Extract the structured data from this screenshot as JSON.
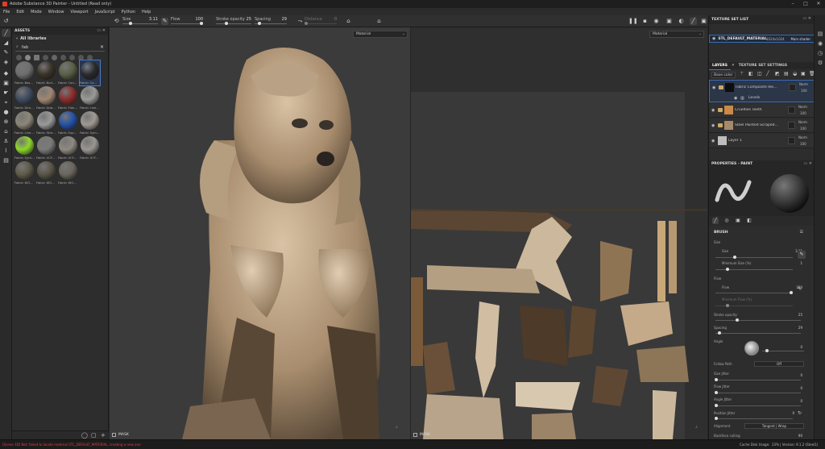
{
  "window": {
    "title": "Adobe Substance 3D Painter - Untitled (Read only)"
  },
  "menu": [
    "File",
    "Edit",
    "Mode",
    "Window",
    "Viewport",
    "JavaScript",
    "Python",
    "Help"
  ],
  "toolbar": {
    "size_label": "Size",
    "size_value": "3.11",
    "flow_label": "Flow",
    "flow_value": "100",
    "stroke_label": "Stroke opacity",
    "stroke_value": "25",
    "spacing_label": "Spacing",
    "spacing_value": "29",
    "distance_label": "Distance",
    "distance_value": "0"
  },
  "assets": {
    "title": "ASSETS",
    "library": "All libraries",
    "search_value": "fab",
    "tiles": [
      {
        "label": "Fabric Bas...",
        "color": "#6e6e6e"
      },
      {
        "label": "Fabric Burl...",
        "color": "#3a3226"
      },
      {
        "label": "Fabric Can...",
        "color": "#5a5f45"
      },
      {
        "label": "Fabric Co...",
        "color": "#2a2a2a"
      },
      {
        "label": "Fabric Den...",
        "color": "#3e4a5e"
      },
      {
        "label": "Fabric Dob...",
        "color": "#a08672"
      },
      {
        "label": "Fabric Flan...",
        "color": "#8a2c2c"
      },
      {
        "label": "Fabric Line...",
        "color": "#9a9a98"
      },
      {
        "label": "Fabric Line...",
        "color": "#8c8778"
      },
      {
        "label": "Fabric Stre...",
        "color": "#9a9a9a"
      },
      {
        "label": "Fabric Sup...",
        "color": "#2352a8"
      },
      {
        "label": "Fabric Sym...",
        "color": "#a09a92"
      },
      {
        "label": "Fabric Synt...",
        "color": "#8dd62a"
      },
      {
        "label": "Fabric UCF...",
        "color": "#7a7a78"
      },
      {
        "label": "Fabric UCF...",
        "color": "#8e8a80"
      },
      {
        "label": "Fabric UCF...",
        "color": "#9a9690"
      },
      {
        "label": "Fabric WO...",
        "color": "#5e5a48"
      },
      {
        "label": "Fabric WO...",
        "color": "#585446"
      },
      {
        "label": "Fabric WO...",
        "color": "#6a665c"
      }
    ]
  },
  "viewport3d": {
    "dropdown": "Material",
    "mask_label": "MASK"
  },
  "viewport2d": {
    "dropdown": "Material",
    "mask_label": "MASK"
  },
  "texture_set_list": {
    "title": "TEXTURE SET LIST",
    "name": "STL_DEFAULT_MATERIAL",
    "resolution": "1024x1024",
    "shader": "Main shader"
  },
  "layers": {
    "tab_layers": "LAYERS",
    "tab_tss": "TEXTURE SET SETTINGS",
    "channel": "Base color",
    "items": [
      {
        "name": "Fabric Composite Reinfor...",
        "blend": "Norm",
        "opacity": "100",
        "sub": "Levels"
      },
      {
        "name": "Cruelties Teeth",
        "blend": "Norm",
        "opacity": "100"
      },
      {
        "name": "Steel Painted Scraped Dirty",
        "blend": "Norm",
        "opacity": "100"
      },
      {
        "name": "Layer 1",
        "blend": "Norm",
        "opacity": "100"
      }
    ]
  },
  "properties": {
    "title": "PROPERTIES - PAINT",
    "brush_title": "BRUSH",
    "size_section": "Size",
    "size_label": "Size",
    "size_value": "3.11",
    "min_size_label": "Minimum Size (%)",
    "min_size_value": "1",
    "flow_section": "Flow",
    "flow_label": "Flow",
    "flow_value": "100",
    "min_flow_label": "Minimum Flow (%)",
    "stroke_label": "Stroke opacity",
    "stroke_value": "25",
    "spacing_label": "Spacing",
    "spacing_value": "29",
    "angle_label": "Angle",
    "angle_value": "0",
    "follow_path_label": "Follow Path",
    "follow_path_value": "Off",
    "size_jitter_label": "Size Jitter",
    "size_jitter_value": "0",
    "flow_jitter_label": "Flow Jitter",
    "flow_jitter_value": "0",
    "angle_jitter_label": "Angle Jitter",
    "angle_jitter_value": "0",
    "position_jitter_label": "Position Jitter",
    "position_jitter_value": "0",
    "alignment_label": "Alignment",
    "alignment_value": "Tangent | Wrap",
    "backface_label": "Backface culling",
    "backface_value": "90"
  },
  "status": {
    "error": "[Scene 3D] Not: failed to locate material STL_DEFAULT_MATERIAL, creating a new one",
    "cache": "Cache Disk Usage:",
    "version": "23% | Version: 9.1.2 (Steel1)"
  },
  "colors": {
    "accent": "#3a6bb0",
    "error": "#e04040",
    "selection": "#4a7ac8"
  }
}
